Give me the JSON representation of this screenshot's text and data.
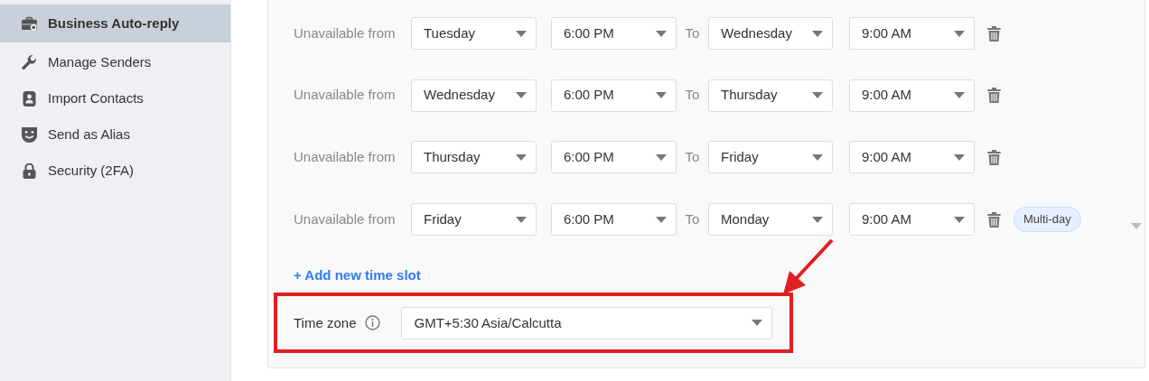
{
  "sidebar": {
    "items": [
      {
        "label": "Business Auto-reply",
        "selected": true
      },
      {
        "label": "Manage Senders",
        "selected": false
      },
      {
        "label": "Import Contacts",
        "selected": false
      },
      {
        "label": "Send as Alias",
        "selected": false
      },
      {
        "label": "Security (2FA)",
        "selected": false
      }
    ]
  },
  "time_slots": [
    {
      "label": "Unavailable from",
      "from_day": "Tuesday",
      "from_time": "6:00 PM",
      "to_label": "To",
      "to_day": "Wednesday",
      "to_time": "9:00 AM"
    },
    {
      "label": "Unavailable from",
      "from_day": "Wednesday",
      "from_time": "6:00 PM",
      "to_label": "To",
      "to_day": "Thursday",
      "to_time": "9:00 AM"
    },
    {
      "label": "Unavailable from",
      "from_day": "Thursday",
      "from_time": "6:00 PM",
      "to_label": "To",
      "to_day": "Friday",
      "to_time": "9:00 AM"
    },
    {
      "label": "Unavailable from",
      "from_day": "Friday",
      "from_time": "6:00 PM",
      "to_label": "To",
      "to_day": "Monday",
      "to_time": "9:00 AM",
      "badge": "Multi-day"
    }
  ],
  "add_link": "+ Add new time slot",
  "time_zone": {
    "label": "Time zone",
    "value": "GMT+5:30 Asia/Calcutta"
  },
  "annotation": {
    "kind": "box_with_arrow"
  }
}
